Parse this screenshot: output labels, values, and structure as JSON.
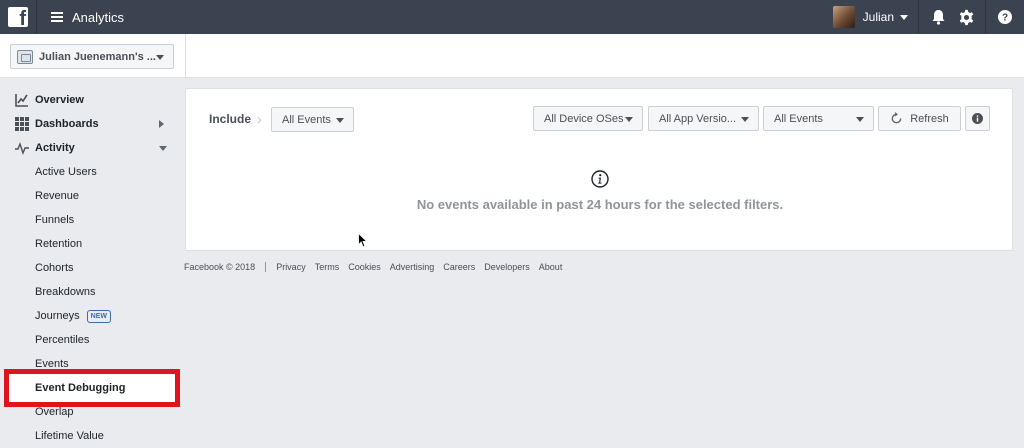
{
  "header": {
    "logo_letter": "f",
    "app_title": "Analytics",
    "user_name": "Julian"
  },
  "account_selector": {
    "value": "Julian Juenemann's ..."
  },
  "sidebar": {
    "top_items": [
      {
        "label": "Overview",
        "icon": "overview-chart-icon"
      },
      {
        "label": "Dashboards",
        "icon": "dashboards-grid-icon"
      },
      {
        "label": "Activity",
        "icon": "activity-pulse-icon"
      }
    ],
    "activity_items": [
      "Active Users",
      "Revenue",
      "Funnels",
      "Retention",
      "Cohorts",
      "Breakdowns",
      "Journeys",
      "Percentiles",
      "Events",
      "Event Debugging",
      "Overlap",
      "Lifetime Value"
    ],
    "new_badge": "NEW",
    "selected": "Event Debugging",
    "highlight_color": "#e0141e"
  },
  "toolbar": {
    "include_label": "Include",
    "include_value": "All Events",
    "filters": [
      "All Device OSes",
      "All App Versio...",
      "All Events"
    ],
    "refresh_label": "Refresh"
  },
  "empty_state": {
    "message": "No events available in past 24 hours for the selected filters."
  },
  "footer": {
    "copyright": "Facebook © 2018",
    "links": [
      "Privacy",
      "Terms",
      "Cookies",
      "Advertising",
      "Careers",
      "Developers",
      "About"
    ]
  },
  "colors": {
    "topbar": "#3b4350",
    "background": "#e9ebee",
    "badge": "#4267b2"
  }
}
